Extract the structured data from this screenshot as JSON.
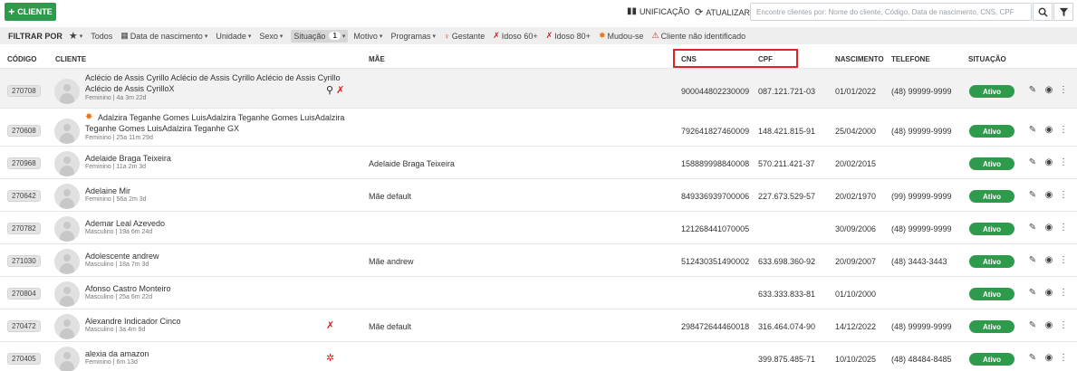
{
  "toolbar": {
    "new_client_label": "CLIENTE",
    "unification_label": "UNIFICAÇÃO",
    "refresh_label": "ATUALIZAR",
    "search_placeholder": "Encontre clientes por: Nome do cliente, Código, Data de nascimento, CNS, CPF"
  },
  "filters": {
    "label": "FILTRAR POR",
    "items": [
      {
        "label": "Todos"
      },
      {
        "label": "Data de nascimento"
      },
      {
        "label": "Unidade"
      },
      {
        "label": "Sexo"
      },
      {
        "label": "Situação",
        "count": "1"
      },
      {
        "label": "Motivo"
      },
      {
        "label": "Programas"
      },
      {
        "label": "Gestante"
      },
      {
        "label": "Idoso 60+"
      },
      {
        "label": "Idoso 80+"
      },
      {
        "label": "Mudou-se"
      },
      {
        "label": "Cliente não identificado"
      }
    ]
  },
  "table": {
    "headers": {
      "code": "CÓDIGO",
      "client": "CLIENTE",
      "mother": "MÃE",
      "cns": "CNS",
      "cpf": "CPF",
      "birth": "NASCIMENTO",
      "phone": "TELEFONE",
      "status": "SITUAÇÃO"
    },
    "rows": [
      {
        "code": "270708",
        "name": "Aclécio de Assis Cyrillo Aclécio de Assis Cyrillo Aclécio de Assis Cyrillo Aclécio de Assis CyrilloX",
        "sub": "Feminino | 4a 3m 22d",
        "mother": "",
        "cns": "900044802230009",
        "cpf": "087.121.721-03",
        "birth": "01/01/2022",
        "phone": "(48) 99999-9999",
        "status": "Ativo"
      },
      {
        "code": "270608",
        "name": "Adalzira Teganhe Gomes LuisAdalzira Teganhe Gomes LuisAdalzira Teganhe Gomes LuisAdalzira Teganhe GX",
        "sub": "Feminino | 25a 11m 29d",
        "mother": "",
        "cns": "792641827460009",
        "cpf": "148.421.815-91",
        "birth": "25/04/2000",
        "phone": "(48) 99999-9999",
        "status": "Ativo"
      },
      {
        "code": "270968",
        "name": "Adelaide Braga Teixeira",
        "sub": "Feminino | 11a 2m 3d",
        "mother": "Adelaide Braga Teixeira",
        "cns": "158889998840008",
        "cpf": "570.211.421-37",
        "birth": "20/02/2015",
        "phone": "",
        "status": "Ativo"
      },
      {
        "code": "270642",
        "name": "Adelaine Mir",
        "sub": "Feminino | 56a 2m 3d",
        "mother": "Mãe default",
        "cns": "849336939700006",
        "cpf": "227.673.529-57",
        "birth": "20/02/1970",
        "phone": "(99) 99999-9999",
        "status": "Ativo"
      },
      {
        "code": "270782",
        "name": "Ademar Leal Azevedo",
        "sub": "Masculino | 19a 6m 24d",
        "mother": "",
        "cns": "121268441070005",
        "cpf": "",
        "birth": "30/09/2006",
        "phone": "(48) 99999-9999",
        "status": "Ativo"
      },
      {
        "code": "271030",
        "name": "Adolescente andrew",
        "sub": "Masculino | 18a 7m 3d",
        "mother": "Mãe andrew",
        "cns": "512430351490002",
        "cpf": "633.698.360-92",
        "birth": "20/09/2007",
        "phone": "(48) 3443-3443",
        "status": "Ativo"
      },
      {
        "code": "270804",
        "name": "Afonso Castro Monteiro",
        "sub": "Masculino | 25a 6m 22d",
        "mother": "",
        "cns": "",
        "cpf": "633.333.833-81",
        "birth": "01/10/2000",
        "phone": "",
        "status": "Ativo"
      },
      {
        "code": "270472",
        "name": "Alexandre Indicador Cinco",
        "sub": "Masculino | 3a 4m 9d",
        "mother": "Mãe default",
        "cns": "298472644460018",
        "cpf": "316.464.074-90",
        "birth": "14/12/2022",
        "phone": "(48) 99999-9999",
        "status": "Ativo"
      },
      {
        "code": "270405",
        "name": "alexia da amazon",
        "sub": "Feminino | 6m 13d",
        "mother": "",
        "cns": "",
        "cpf": "399.875.485-71",
        "birth": "10/10/2025",
        "phone": "(48) 48484-8485",
        "status": "Ativo"
      }
    ]
  },
  "colors": {
    "primary_green": "#2e9b4c",
    "highlight_red": "#e02424",
    "filter_bar_bg": "#eeeeee"
  },
  "icons": {
    "new": "plus-icon",
    "unification": "unification-icon",
    "refresh": "refresh-icon",
    "search": "search-icon",
    "filter": "filter-funnel-icon",
    "star": "star-icon",
    "calendar": "calendar-icon",
    "pregnant": "pregnant-icon",
    "elderly": "elderly-icon",
    "moved": "moved-icon",
    "warning": "warning-icon",
    "edit": "pencil-icon",
    "view": "eye-icon",
    "more": "more-vertical-icon"
  }
}
